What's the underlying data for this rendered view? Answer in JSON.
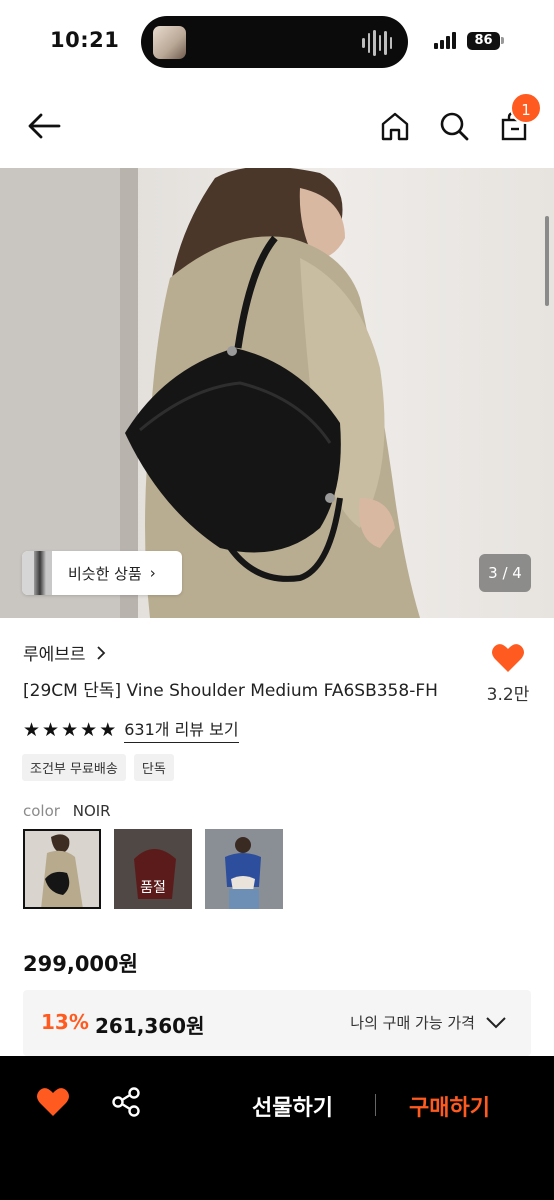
{
  "status_bar": {
    "time": "10:21",
    "battery": "86"
  },
  "nav": {
    "cart_count": "1"
  },
  "hero": {
    "similar_label": "비슷한 상품",
    "counter": "3 / 4"
  },
  "product": {
    "brand": "루에브르",
    "name": "[29CM 단독] Vine Shoulder Medium FA6SB358-FH",
    "like_count": "3.2만",
    "rating_stars": 5,
    "review_link": "631개 리뷰 보기",
    "tags": [
      "조건부 무료배송",
      "단독"
    ],
    "color_label": "color",
    "color_value": "NOIR",
    "swatches": [
      {
        "name": "noir",
        "label": ""
      },
      {
        "name": "red",
        "label": "품절"
      },
      {
        "name": "cream",
        "label": ""
      }
    ],
    "price": "299,000원",
    "discount_pct": "13%",
    "discount_price": "261,360원",
    "my_price_label": "나의 구매 가능 가격"
  },
  "bottom_bar": {
    "gift_label": "선물하기",
    "buy_label": "구매하기"
  },
  "colors": {
    "accent": "#ff5a1f",
    "heart": "#ff5a1f"
  },
  "icons": [
    "back-arrow-icon",
    "home-icon",
    "search-icon",
    "cart-icon",
    "heart-icon",
    "share-icon",
    "chevron-down-icon"
  ]
}
